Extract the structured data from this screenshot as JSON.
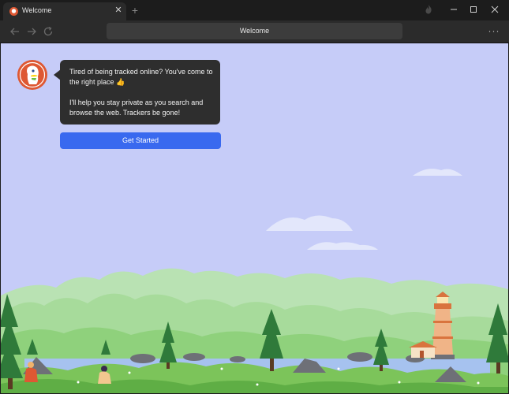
{
  "tab": {
    "title": "Welcome",
    "close_glyph": "✕"
  },
  "new_tab_glyph": "+",
  "addressbar": {
    "text": "Welcome"
  },
  "menu_glyph": "···",
  "onboarding": {
    "message_line1": "Tired of being tracked online?  You've come to the right place 👍",
    "message_line2": "I'll help you stay private as you search and browse the web. Trackers be gone!",
    "cta_label": "Get Started"
  },
  "colors": {
    "brand_orange": "#de5833",
    "button_blue": "#3969ef",
    "sky": "#c6ccf8",
    "bubble": "#2e2e2e"
  },
  "icons": {
    "window_controls": [
      "fire-icon",
      "minimize-icon",
      "maximize-icon",
      "close-icon"
    ],
    "navigation": [
      "back-arrow-icon",
      "forward-arrow-icon",
      "reload-icon"
    ]
  }
}
